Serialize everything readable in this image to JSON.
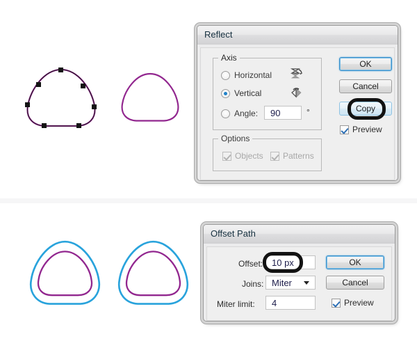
{
  "app": {
    "kind": "vector-illustration-editor",
    "canvas_background": "#ffffff",
    "divider_color": "#f6f6f7"
  },
  "artwork": {
    "stroke_purple": "#92278f",
    "stroke_blue": "#29a3dc",
    "anchor_color": "#1a1a1a",
    "shapes": [
      {
        "name": "original-path-with-anchors",
        "panel": "top",
        "stroke": "#92278f",
        "anchors_visible": true
      },
      {
        "name": "reflected-copy-path",
        "panel": "top",
        "stroke": "#92278f",
        "anchors_visible": false
      },
      {
        "name": "offset-left-pair",
        "panel": "bottom",
        "inner_stroke": "#92278f",
        "outer_stroke": "#29a3dc"
      },
      {
        "name": "offset-right-pair",
        "panel": "bottom",
        "inner_stroke": "#92278f",
        "outer_stroke": "#29a3dc"
      }
    ]
  },
  "reflect_dialog": {
    "title": "Reflect",
    "axis_group": {
      "legend": "Axis",
      "options": [
        {
          "label": "Horizontal",
          "selected": false,
          "icon": "reflect-horizontal-icon"
        },
        {
          "label": "Vertical",
          "selected": true,
          "icon": "reflect-vertical-icon"
        },
        {
          "label": "Angle:",
          "selected": false,
          "icon": ""
        }
      ],
      "angle_value": "90",
      "angle_unit": "°"
    },
    "options_group": {
      "legend": "Options",
      "checkboxes": [
        {
          "label": "Objects",
          "checked": true,
          "disabled": true
        },
        {
          "label": "Patterns",
          "checked": true,
          "disabled": true
        }
      ]
    },
    "buttons": [
      {
        "label": "OK",
        "style": "default"
      },
      {
        "label": "Cancel",
        "style": "normal"
      },
      {
        "label": "Copy",
        "style": "softblue",
        "highlighted": true
      }
    ],
    "preview": {
      "label": "Preview",
      "checked": true
    }
  },
  "offset_path_dialog": {
    "title": "Offset Path",
    "fields": [
      {
        "label": "Offset:",
        "value": "10 px",
        "highlighted": true
      },
      {
        "label": "Joins:",
        "value": "Miter",
        "type": "dropdown"
      },
      {
        "label": "Miter limit:",
        "value": "4"
      }
    ],
    "buttons": [
      {
        "label": "OK",
        "style": "default"
      },
      {
        "label": "Cancel",
        "style": "normal"
      }
    ],
    "preview": {
      "label": "Preview",
      "checked": true
    }
  },
  "colors": {
    "accent_blue": "#2182c8",
    "purple": "#92278f",
    "cyan": "#29a3dc",
    "dialog_face": "#efefef",
    "title_text": "#16303f"
  }
}
